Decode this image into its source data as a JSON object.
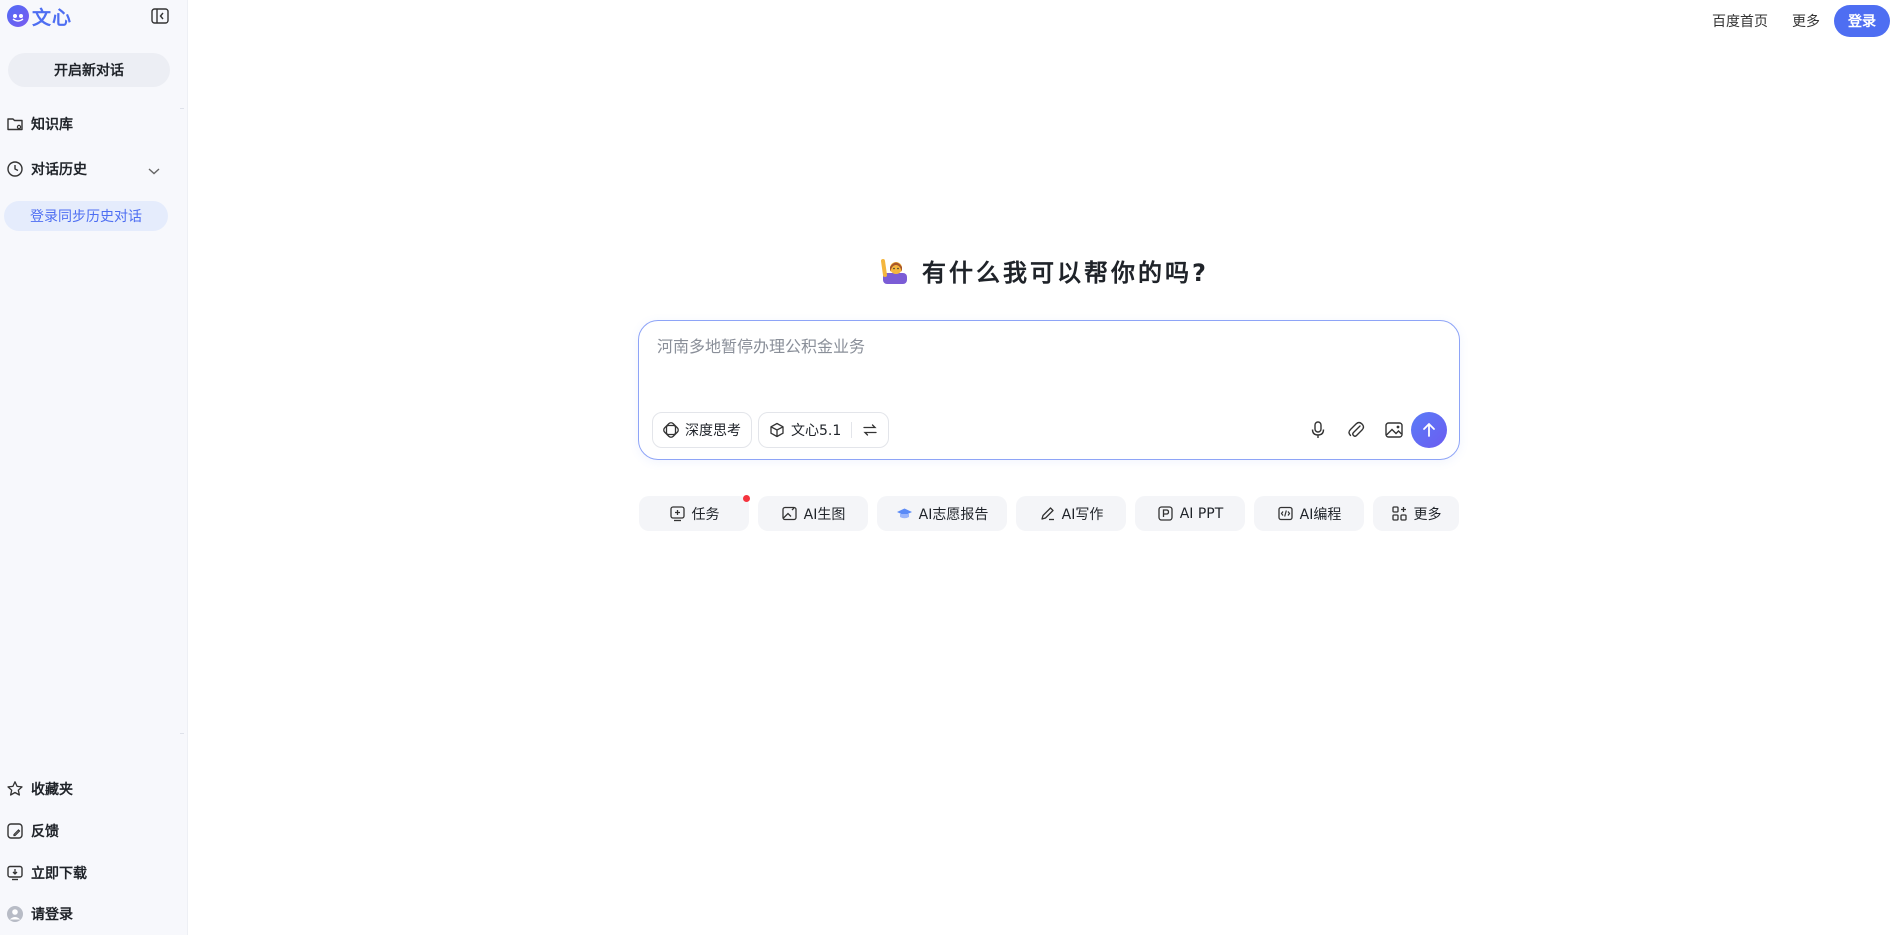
{
  "app": {
    "logo_text": "文心",
    "accent": "#4e6ef2"
  },
  "sidebar": {
    "new_chat_label": "开启新对话",
    "items": [
      {
        "label": "知识库",
        "icon": "folder-icon"
      },
      {
        "label": "对话历史",
        "icon": "clock-icon"
      }
    ],
    "sync_label": "登录同步历史对话",
    "bottom_items": [
      {
        "label": "收藏夹",
        "icon": "star-icon"
      },
      {
        "label": "反馈",
        "icon": "feedback-icon"
      },
      {
        "label": "立即下载",
        "icon": "download-icon"
      },
      {
        "label": "请登录",
        "icon": "user-avatar-icon"
      }
    ]
  },
  "header": {
    "links": [
      "百度首页",
      "更多"
    ],
    "login_label": "登录"
  },
  "main": {
    "greeting": "有什么我可以帮你的吗?",
    "greeting_icon": "person-raising-hand-emoji",
    "input_placeholder": "河南多地暂停办理公积金业务",
    "deep_think_label": "深度思考",
    "model_label": "文心5.1",
    "tools": [
      "microphone-icon",
      "paperclip-icon",
      "image-icon"
    ],
    "quick_actions": [
      {
        "label": "任务",
        "icon": "task-icon",
        "badge": true
      },
      {
        "label": "AI生图",
        "icon": "image-gen-icon"
      },
      {
        "label": "AI志愿报告",
        "icon": "graduation-cap-icon"
      },
      {
        "label": "AI写作",
        "icon": "pen-icon"
      },
      {
        "label": "AI PPT",
        "icon": "ppt-icon"
      },
      {
        "label": "AI编程",
        "icon": "code-icon"
      },
      {
        "label": "更多",
        "icon": "apps-icon"
      }
    ]
  }
}
